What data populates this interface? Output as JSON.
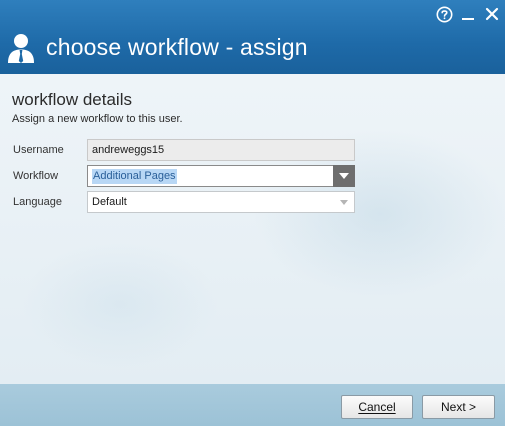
{
  "window": {
    "title": "choose workflow - assign",
    "controls": [
      "help-icon",
      "minimize-icon",
      "close-icon"
    ]
  },
  "details": {
    "heading": "workflow details",
    "subheading": "Assign a new workflow to this user."
  },
  "form": {
    "username_label": "Username",
    "username_value": "andreweggs15",
    "workflow_label": "Workflow",
    "workflow_value": "Additional Pages",
    "language_label": "Language",
    "language_value": "Default"
  },
  "footer": {
    "cancel_label": "Cancel",
    "next_label": "Next >"
  },
  "colors": {
    "header": "#1e6aa8",
    "footer": "#a9cbdd",
    "selection": "#b8d7f5"
  }
}
